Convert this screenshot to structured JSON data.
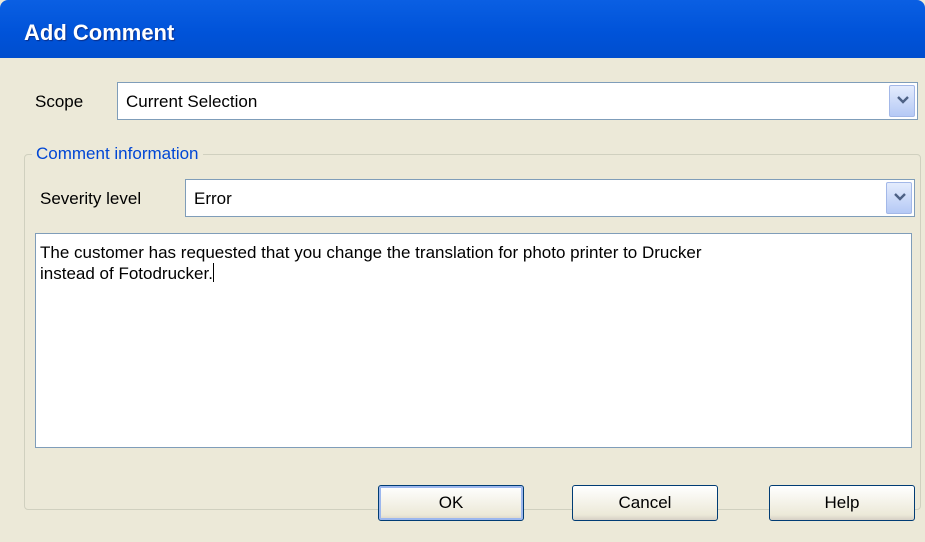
{
  "window": {
    "title": "Add Comment"
  },
  "scope": {
    "label": "Scope",
    "selected": "Current Selection"
  },
  "group": {
    "legend": "Comment information",
    "severity": {
      "label": "Severity level",
      "selected": "Error"
    },
    "comment_text": "The customer has requested that you change the translation for photo printer to Drucker\ninstead of Fotodrucker."
  },
  "buttons": {
    "ok": "OK",
    "cancel": "Cancel",
    "help": "Help"
  },
  "colors": {
    "titlebar": "#0053d9",
    "dialog_bg": "#ece9d8",
    "legend_text": "#0046d5",
    "field_border": "#7f9db9"
  }
}
